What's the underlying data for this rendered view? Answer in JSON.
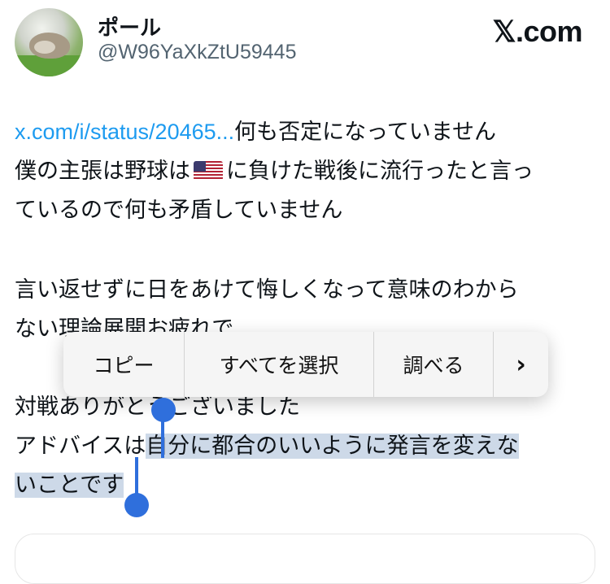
{
  "author": {
    "display_name": "ポール",
    "handle": "@W96YaXkZtU59445",
    "avatar_icon": "hamster-avatar-icon"
  },
  "site_label": "𝕏.com",
  "post": {
    "link_text": "x.com/i/status/20465...",
    "line1_rest": "何も否定になっていません",
    "line2_a": "僕の主張は野球は",
    "flag_icon": "us-flag-icon",
    "line2_b": "に負けた戦後に流行ったと言っ",
    "line3": "ているので何も矛盾していません",
    "line4": "言い返せずに日をあけて悔しくなって意味のわから",
    "line5": "ない理論展開お疲れで",
    "line6": "対戦ありがとうございました",
    "line7_plain": "アドバイスは",
    "line7_selected": "自分に都合のいいように発言を変えな",
    "line8_selected": "いことです"
  },
  "context_menu": {
    "copy": "コピー",
    "select_all": "すべてを選択",
    "look_up": "調べる",
    "more": "›"
  },
  "colors": {
    "link": "#1d9bf0",
    "selection": "#cdd9e8",
    "selection_handle": "#2f6fdc"
  }
}
